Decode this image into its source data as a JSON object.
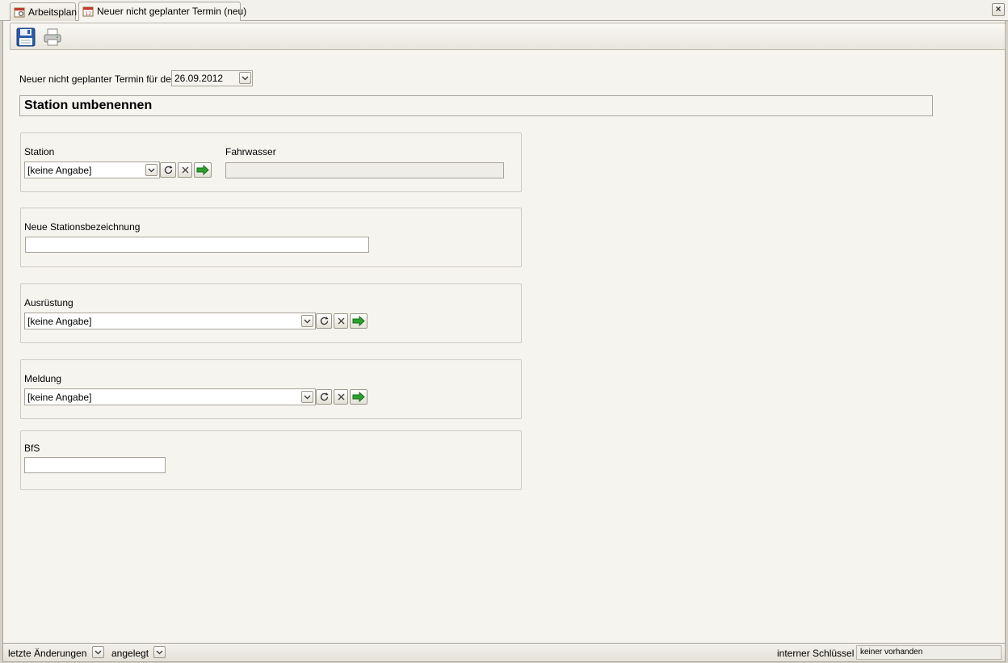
{
  "tabs": [
    {
      "label": "Arbeitsplan",
      "icon": "calendar-gear-icon",
      "active": false
    },
    {
      "label": "Neuer nicht geplanter Termin (neu)",
      "icon": "calendar-icon",
      "active": true
    }
  ],
  "toolbar": {
    "save_icon": "floppy-disk-icon",
    "print_icon": "printer-icon"
  },
  "form": {
    "date_label": "Neuer nicht geplanter Termin für den",
    "date_value": "26.09.2012",
    "heading": "Station umbenennen",
    "station": {
      "label": "Station",
      "value": "[keine Angabe]"
    },
    "fahrwasser": {
      "label": "Fahrwasser",
      "value": ""
    },
    "neue_bezeichnung": {
      "label": "Neue Stationsbezeichnung",
      "value": ""
    },
    "ausruestung": {
      "label": "Ausrüstung",
      "value": "[keine Angabe]"
    },
    "meldung": {
      "label": "Meldung",
      "value": "[keine Angabe]"
    },
    "bfs": {
      "label": "BfS",
      "value": ""
    }
  },
  "statusbar": {
    "last_changes": "letzte Änderungen",
    "created": "angelegt",
    "internal_key_label": "interner Schlüssel",
    "internal_key_value": "keiner vorhanden"
  },
  "colors": {
    "background": "#f6f4ef",
    "border": "#a8a49a",
    "go_green": "#2ca02c"
  }
}
